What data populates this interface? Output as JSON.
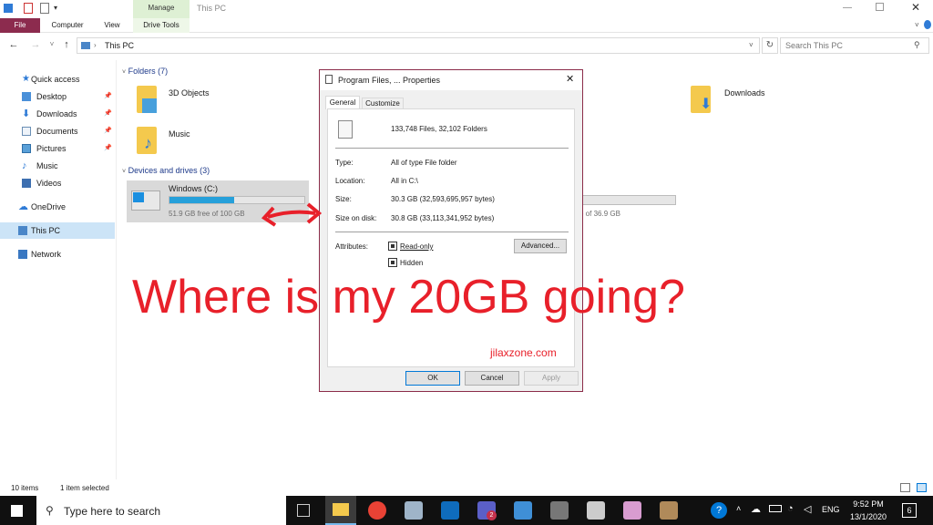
{
  "window": {
    "title": "This PC",
    "manage_label": "Manage",
    "drive_tools_label": "Drive Tools",
    "tabs": [
      "File",
      "Computer",
      "View"
    ]
  },
  "address": {
    "path": "This PC",
    "search_placeholder": "Search This PC"
  },
  "sidebar": {
    "items": [
      {
        "label": "Quick access",
        "icon": "star-icon"
      },
      {
        "label": "Desktop",
        "icon": "desktop-icon",
        "pinned": true
      },
      {
        "label": "Downloads",
        "icon": "download-icon",
        "pinned": true
      },
      {
        "label": "Documents",
        "icon": "documents-icon",
        "pinned": true
      },
      {
        "label": "Pictures",
        "icon": "pictures-icon",
        "pinned": true
      },
      {
        "label": "Music",
        "icon": "music-icon"
      },
      {
        "label": "Videos",
        "icon": "videos-icon"
      },
      {
        "label": "OneDrive",
        "icon": "cloud-icon"
      },
      {
        "label": "This PC",
        "icon": "pc-icon"
      },
      {
        "label": "Network",
        "icon": "network-icon"
      }
    ]
  },
  "main": {
    "folders_header": "Folders (7)",
    "folders": [
      "3D Objects",
      "Downloads",
      "Music"
    ],
    "devices_header": "Devices and drives (3)",
    "drive_name": "Windows  (C:)",
    "drive_free": "51.9 GB free of 100 GB",
    "drive_used_fraction": 0.48,
    "other_drive_free": "e of 36.9 GB"
  },
  "overlay": {
    "headline": "Where is my 20GB going?",
    "watermark": "jilaxzone.com",
    "arrow_color": "#e8202a"
  },
  "dialog": {
    "title": "Program Files, ... Properties",
    "tabs": [
      "General",
      "Customize"
    ],
    "summary": "133,748 Files, 32,102 Folders",
    "rows": [
      {
        "label": "Type:",
        "value": "All of type File folder"
      },
      {
        "label": "Location:",
        "value": "All in C:\\"
      },
      {
        "label": "Size:",
        "value": "30.3 GB (32,593,695,957 bytes)"
      },
      {
        "label": "Size on disk:",
        "value": "30.8 GB (33,113,341,952 bytes)"
      }
    ],
    "attributes_label": "Attributes:",
    "readonly_label": "Read-only",
    "hidden_label": "Hidden",
    "advanced_label": "Advanced...",
    "ok_label": "OK",
    "cancel_label": "Cancel",
    "apply_label": "Apply"
  },
  "status": {
    "items": "10 items",
    "selected": "1 item selected"
  },
  "taskbar": {
    "search_placeholder": "Type here to search",
    "lang": "ENG",
    "time": "9:52 PM",
    "date": "13/1/2020",
    "notif_count": "6",
    "teams_badge": "2"
  }
}
